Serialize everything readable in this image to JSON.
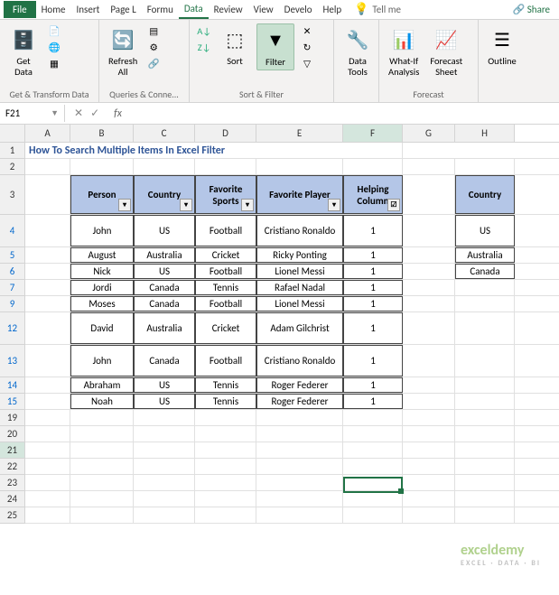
{
  "tabs": {
    "file": "File",
    "home": "Home",
    "insert": "Insert",
    "page": "Page L",
    "formulas": "Formu",
    "data": "Data",
    "review": "Review",
    "view": "View",
    "developer": "Develo",
    "help": "Help",
    "tellme": "Tell me",
    "share": "Share"
  },
  "ribbon": {
    "g1": {
      "label": "Get & Transform Data",
      "getdata": "Get\nData"
    },
    "g2": {
      "label": "Queries & Conne...",
      "refresh": "Refresh\nAll"
    },
    "g3": {
      "label": "Sort & Filter",
      "sort": "Sort",
      "filter": "Filter",
      "clear": "Clear",
      "reapply": "Reapply",
      "advanced": "Advanced"
    },
    "g4": {
      "label": "",
      "tools": "Data\nTools"
    },
    "g5": {
      "label": "Forecast",
      "whatif": "What-If\nAnalysis",
      "forecast": "Forecast\nSheet"
    },
    "g6": {
      "label": "",
      "outline": "Outline"
    }
  },
  "namebox": "F21",
  "fx": "fx",
  "cols": [
    "A",
    "B",
    "C",
    "D",
    "E",
    "F",
    "G",
    "H"
  ],
  "title": "How To Search Multiple Items In Excel Filter",
  "headers": {
    "person": "Person",
    "country": "Country",
    "sports": "Favorite Sports",
    "player": "Favorite Player",
    "helping": "Helping Column"
  },
  "data": [
    {
      "r": "4",
      "p": "John",
      "c": "US",
      "s": "Football",
      "pl": "Cristiano Ronaldo",
      "h": "1"
    },
    {
      "r": "5",
      "p": "August",
      "c": "Australia",
      "s": "Cricket",
      "pl": "Ricky Ponting",
      "h": "1"
    },
    {
      "r": "6",
      "p": "Nick",
      "c": "US",
      "s": "Football",
      "pl": "Lionel Messi",
      "h": "1"
    },
    {
      "r": "7",
      "p": "Jordi",
      "c": "Canada",
      "s": "Tennis",
      "pl": "Rafael Nadal",
      "h": "1"
    },
    {
      "r": "9",
      "p": "Moses",
      "c": "Canada",
      "s": "Football",
      "pl": "Lionel Messi",
      "h": "1"
    },
    {
      "r": "12",
      "p": "David",
      "c": "Australia",
      "s": "Cricket",
      "pl": "Adam Gilchrist",
      "h": "1"
    },
    {
      "r": "13",
      "p": "John",
      "c": "Canada",
      "s": "Football",
      "pl": "Cristiano Ronaldo",
      "h": "1"
    },
    {
      "r": "14",
      "p": "Abraham",
      "c": "US",
      "s": "Tennis",
      "pl": "Roger Federer",
      "h": "1"
    },
    {
      "r": "15",
      "p": "Noah",
      "c": "US",
      "s": "Tennis",
      "pl": "Roger Federer",
      "h": "1"
    }
  ],
  "sidetable": {
    "header": "Country",
    "rows": [
      "US",
      "Australia",
      "Canada"
    ]
  },
  "emptyrows": [
    "19",
    "20",
    "21",
    "22",
    "23",
    "24",
    "25"
  ],
  "logo": {
    "name": "exceldemy",
    "tag": "EXCEL · DATA · BI"
  }
}
